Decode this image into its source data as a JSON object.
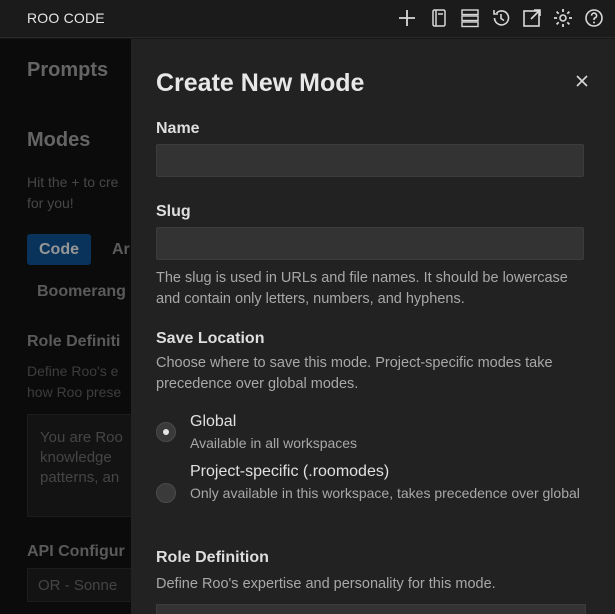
{
  "app": {
    "title": "ROO CODE"
  },
  "toolbar": {
    "icons": [
      "plus-icon",
      "notebook-icon",
      "server-icon",
      "history-icon",
      "external-link-icon",
      "gear-icon",
      "help-icon"
    ]
  },
  "background": {
    "prompts_title": "Prompts",
    "modes_title": "Modes",
    "modes_hint": "Hit the + to cre for you!",
    "mode_tabs": [
      "Code",
      "Ar",
      "Boomerang"
    ],
    "role_title": "Role Definiti",
    "role_desc": "Define Roo's e how Roo prese",
    "role_text": "You are Roo knowledge patterns, an",
    "api_title": "API Configur",
    "api_value": "OR - Sonne"
  },
  "modal": {
    "title": "Create New Mode",
    "name_label": "Name",
    "name_value": "",
    "slug_label": "Slug",
    "slug_value": "",
    "slug_help": "The slug is used in URLs and file names. It should be lowercase and contain only letters, numbers, and hyphens.",
    "save_location_label": "Save Location",
    "save_location_help": "Choose where to save this mode. Project-specific modes take precedence over global modes.",
    "options": [
      {
        "label": "Global",
        "desc": "Available in all workspaces",
        "checked": true
      },
      {
        "label": "Project-specific (.roomodes)",
        "desc": "Only available in this workspace, takes precedence over global",
        "checked": false
      }
    ],
    "role_label": "Role Definition",
    "role_help": "Define Roo's expertise and personality for this mode."
  },
  "colors": {
    "accent": "#0e4f8a",
    "modal_bg": "#222222",
    "input_bg": "#333333"
  }
}
